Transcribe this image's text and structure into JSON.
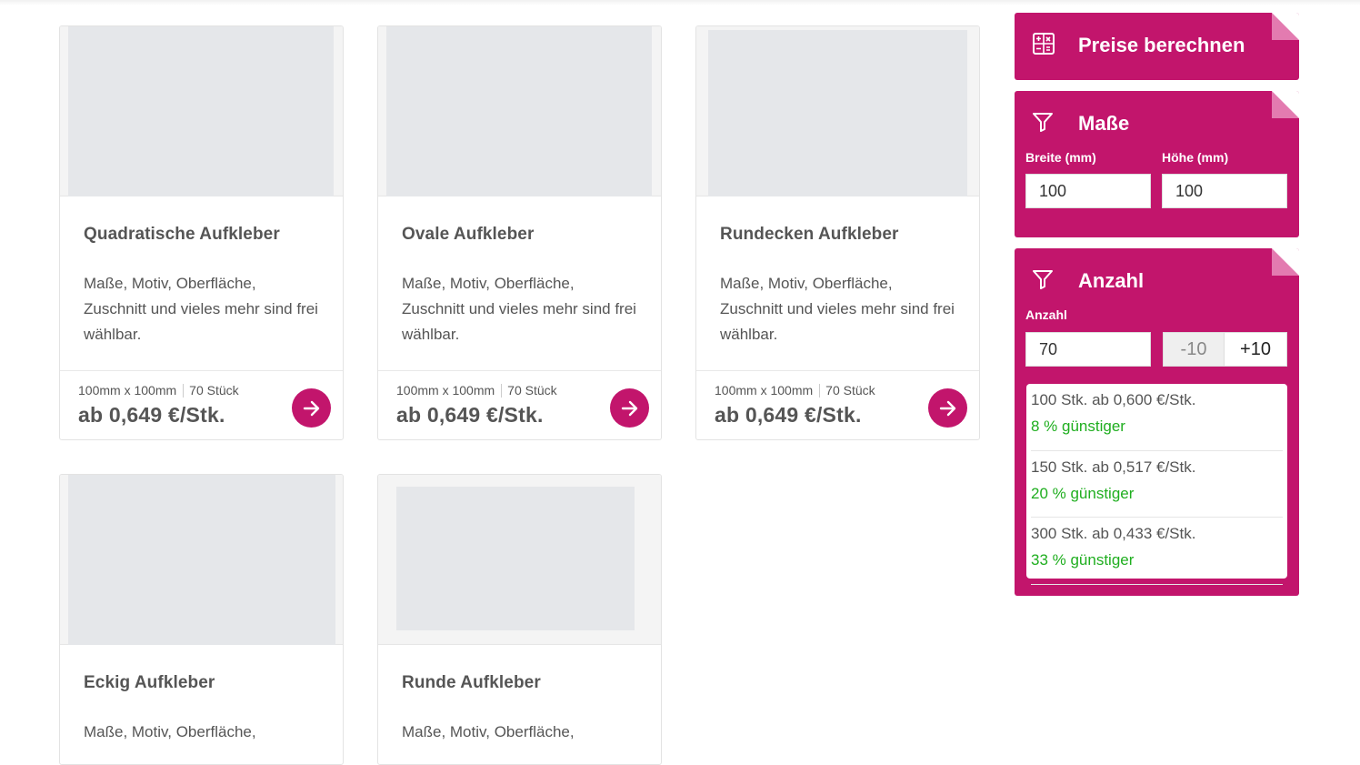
{
  "products": [
    {
      "title": "Quadratische Aufkleber",
      "desc": "Maße, Motiv, Oberfläche, Zuschnitt und vieles mehr sind frei wählbar.",
      "size": "100mm x 100mm",
      "qty": "70 Stück",
      "price": "ab 0,649 €/Stk."
    },
    {
      "title": "Ovale Aufkleber",
      "desc": "Maße, Motiv, Oberfläche, Zuschnitt und vieles mehr sind frei wählbar.",
      "size": "100mm x 100mm",
      "qty": "70 Stück",
      "price": "ab 0,649 €/Stk."
    },
    {
      "title": "Rundecken Aufkleber",
      "desc": "Maße, Motiv, Oberfläche, Zuschnitt und vieles mehr sind frei wählbar.",
      "size": "100mm x 100mm",
      "qty": "70 Stück",
      "price": "ab 0,649 €/Stk."
    },
    {
      "title": "Eckig Aufkleber",
      "desc": "Maße, Motiv, Oberfläche,"
    },
    {
      "title": "Runde Aufkleber",
      "desc": "Maße, Motiv, Oberfläche,"
    }
  ],
  "sidebar": {
    "calc": {
      "title": "Preise berechnen",
      "icon": "calculator-icon"
    },
    "dims": {
      "title": "Maße",
      "icon": "filter-icon",
      "width_label": "Breite (mm)",
      "width_value": "100",
      "height_label": "Höhe (mm)",
      "height_value": "100"
    },
    "qty": {
      "title": "Anzahl",
      "icon": "filter-icon",
      "label": "Anzahl",
      "value": "70",
      "minus": "-10",
      "plus": "+10",
      "tiers": [
        {
          "line": "100 Stk. ab 0,600 €/Stk.",
          "saving": "8 % günstiger"
        },
        {
          "line": "150 Stk. ab 0,517 €/Stk.",
          "saving": "20 % günstiger"
        },
        {
          "line": "300 Stk. ab 0,433 €/Stk.",
          "saving": "33 % günstiger"
        }
      ]
    }
  },
  "colors": {
    "brand": "#c2156c",
    "saving": "#1fae1f"
  }
}
